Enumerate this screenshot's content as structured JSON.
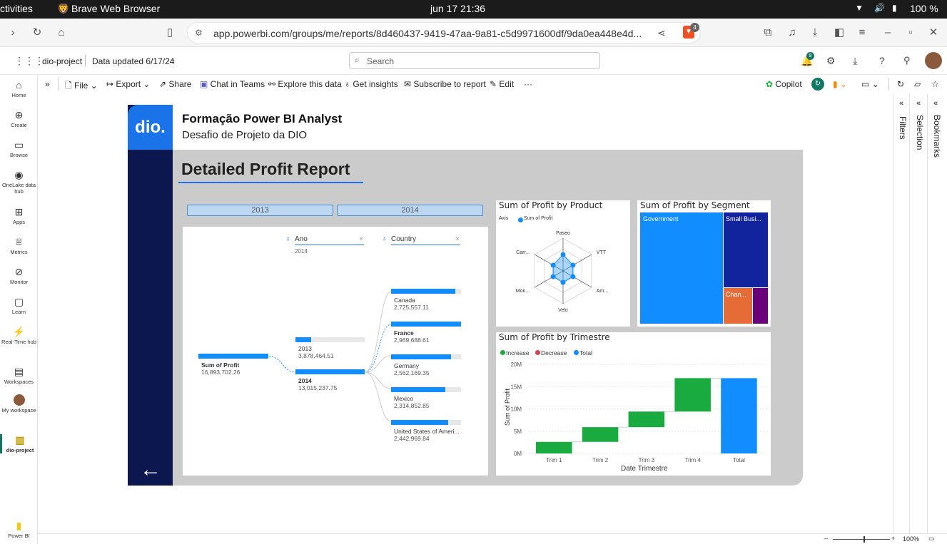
{
  "os": {
    "activities": "ctivities",
    "app_name": "Brave Web Browser",
    "clock": "jun 17  21:36",
    "battery": "100 %"
  },
  "browser": {
    "url": "app.powerbi.com/groups/me/reports/8d460437-9419-47aa-9a81-c5d9971600df/9da0ea448e4d...",
    "shield_count": "4"
  },
  "pbi": {
    "workspace": "dio-project",
    "data_updated": "Data updated 6/17/24",
    "search_placeholder": "Search",
    "notif_count": "9",
    "toolbar": {
      "file": "File",
      "export": "Export",
      "share": "Share",
      "chat": "Chat in Teams",
      "explore": "Explore this data",
      "insights": "Get insights",
      "subscribe": "Subscribe to report",
      "edit": "Edit",
      "more": "···",
      "copilot": "Copilot"
    },
    "nav": [
      {
        "label": "Home",
        "icon": "home-icon"
      },
      {
        "label": "Create",
        "icon": "plus-icon"
      },
      {
        "label": "Browse",
        "icon": "folder-icon"
      },
      {
        "label": "OneLake data hub",
        "icon": "onelake-icon"
      },
      {
        "label": "Apps",
        "icon": "apps-icon"
      },
      {
        "label": "Metrics",
        "icon": "trophy-icon"
      },
      {
        "label": "Monitor",
        "icon": "monitor-icon"
      },
      {
        "label": "Learn",
        "icon": "book-icon"
      },
      {
        "label": "Real-Time hub",
        "icon": "realtime-icon"
      },
      {
        "label": "Workspaces",
        "icon": "workspaces-icon"
      },
      {
        "label": "My workspace",
        "icon": "avatar-icon"
      },
      {
        "label": "dio-project",
        "icon": "report-icon"
      },
      {
        "label": "Power BI",
        "icon": "powerbi-icon"
      }
    ],
    "panes": {
      "filters": "Filters",
      "selection": "Selection",
      "bookmarks": "Bookmarks"
    },
    "zoom": "100%"
  },
  "report": {
    "logo": "dio.",
    "title": "Formação Power BI Analyst",
    "subtitle": "Desafio de Projeto da DIO",
    "heading": "Detailed Profit Report",
    "slicer": [
      "2013",
      "2014"
    ],
    "decomp": {
      "ano_label": "Ano",
      "ano_value": "2014",
      "country_label": "Country",
      "root": {
        "label": "Sum of Profit",
        "value": "16,893,702.26"
      },
      "years": [
        {
          "label": "2013",
          "value": "3,878,464.51",
          "fraction": 0.23
        },
        {
          "label": "2014",
          "value": "13,015,237.75",
          "fraction": 1.0
        }
      ],
      "countries": [
        {
          "label": "Canada",
          "value": "2,725,557.11",
          "fraction": 0.92
        },
        {
          "label": "France",
          "value": "2,969,688.61",
          "fraction": 1.0
        },
        {
          "label": "Germany",
          "value": "2,562,169.35",
          "fraction": 0.86
        },
        {
          "label": "Mexico",
          "value": "2,314,852.85",
          "fraction": 0.78
        },
        {
          "label": "United States of Ameri...",
          "value": "2,442,969.84",
          "fraction": 0.82
        }
      ]
    },
    "radar": {
      "title": "Sum of Profit by Product",
      "axis_label": "Axis",
      "legend": "Sum of Profit",
      "axes": [
        "Paseo",
        "VTT",
        "Am...",
        "Velo",
        "Mon...",
        "Carr..."
      ]
    },
    "treemap": {
      "title": "Sum of Profit by Segment",
      "segments": [
        "Government",
        "Small Busi...",
        "Chan..."
      ]
    },
    "waterfall": {
      "title": "Sum of Profit by Trimestre",
      "legend": [
        "Increase",
        "Decrease",
        "Total"
      ],
      "xlabel": "Date Trimestre",
      "ylabel": "Sum of Profit",
      "yticks": [
        "20M",
        "15M",
        "10M",
        "5M",
        "0M"
      ]
    }
  },
  "chart_data": {
    "type": "bar",
    "title": "Sum of Profit by Trimestre",
    "xlabel": "Date Trimestre",
    "ylabel": "Sum of Profit",
    "categories": [
      "Trim 1",
      "Trim 2",
      "Trim 3",
      "Trim 4",
      "Total"
    ],
    "series": [
      {
        "name": "Increase",
        "start": [
          0,
          2.6,
          5.9,
          9.4,
          0
        ],
        "end": [
          2.6,
          5.9,
          9.4,
          16.9,
          16.9
        ]
      }
    ],
    "ylim": [
      0,
      20
    ],
    "colors": {
      "increase": "#1aab40",
      "decrease": "#d64550",
      "total": "#118dff"
    }
  }
}
